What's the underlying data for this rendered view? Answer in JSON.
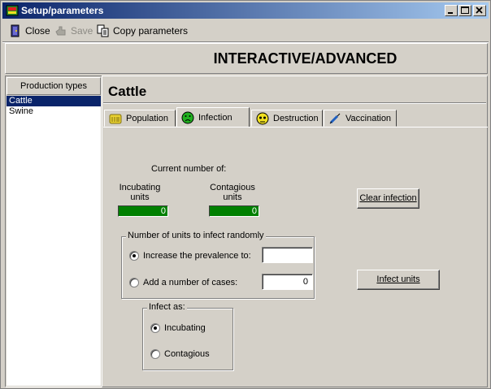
{
  "window": {
    "title": "Setup/parameters"
  },
  "toolbar": {
    "close_label": "Close",
    "save_label": "Save",
    "copy_label": "Copy parameters"
  },
  "header": {
    "title": "INTERACTIVE/ADVANCED"
  },
  "production_types": {
    "header": "Production types",
    "items": [
      {
        "label": "Cattle",
        "selected": true
      },
      {
        "label": "Swine",
        "selected": false
      }
    ]
  },
  "detail": {
    "title": "Cattle",
    "tabs": [
      {
        "label": "Population",
        "icon": "cows-icon",
        "active": false
      },
      {
        "label": "Infection",
        "icon": "sick-face-icon",
        "active": true
      },
      {
        "label": "Destruction",
        "icon": "skull-icon",
        "active": false
      },
      {
        "label": "Vaccination",
        "icon": "syringe-icon",
        "active": false
      }
    ]
  },
  "infection": {
    "current_label": "Current number of:",
    "incubating_label": "Incubating\nunits",
    "contagious_label": "Contagious\nunits",
    "incubating_value": "0",
    "contagious_value": "0",
    "clear_button": "Clear infection",
    "random_group_title": "Number of units to infect randomly",
    "prevalence_option": "Increase the prevalence to:",
    "prevalence_value": "",
    "cases_option": "Add a number of cases:",
    "cases_value": "0",
    "random_mode": "prevalence",
    "infect_button": "Infect units",
    "infect_as_title": "Infect as:",
    "incubating_option": "Incubating",
    "contagious_option": "Contagious",
    "infect_as": "incubating"
  },
  "colors": {
    "titlebar_start": "#0a246a",
    "titlebar_end": "#a6caf0",
    "selection": "#0a246a",
    "bar_fill": "#008000"
  }
}
